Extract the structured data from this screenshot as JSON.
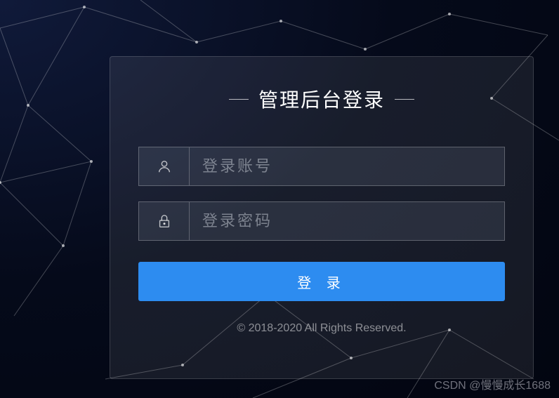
{
  "title": "管理后台登录",
  "username": {
    "placeholder": "登录账号",
    "value": ""
  },
  "password": {
    "placeholder": "登录密码",
    "value": ""
  },
  "login_button_label": "登 录",
  "footer": "© 2018-2020 All Rights Reserved.",
  "watermark": "CSDN @慢慢成长1688"
}
